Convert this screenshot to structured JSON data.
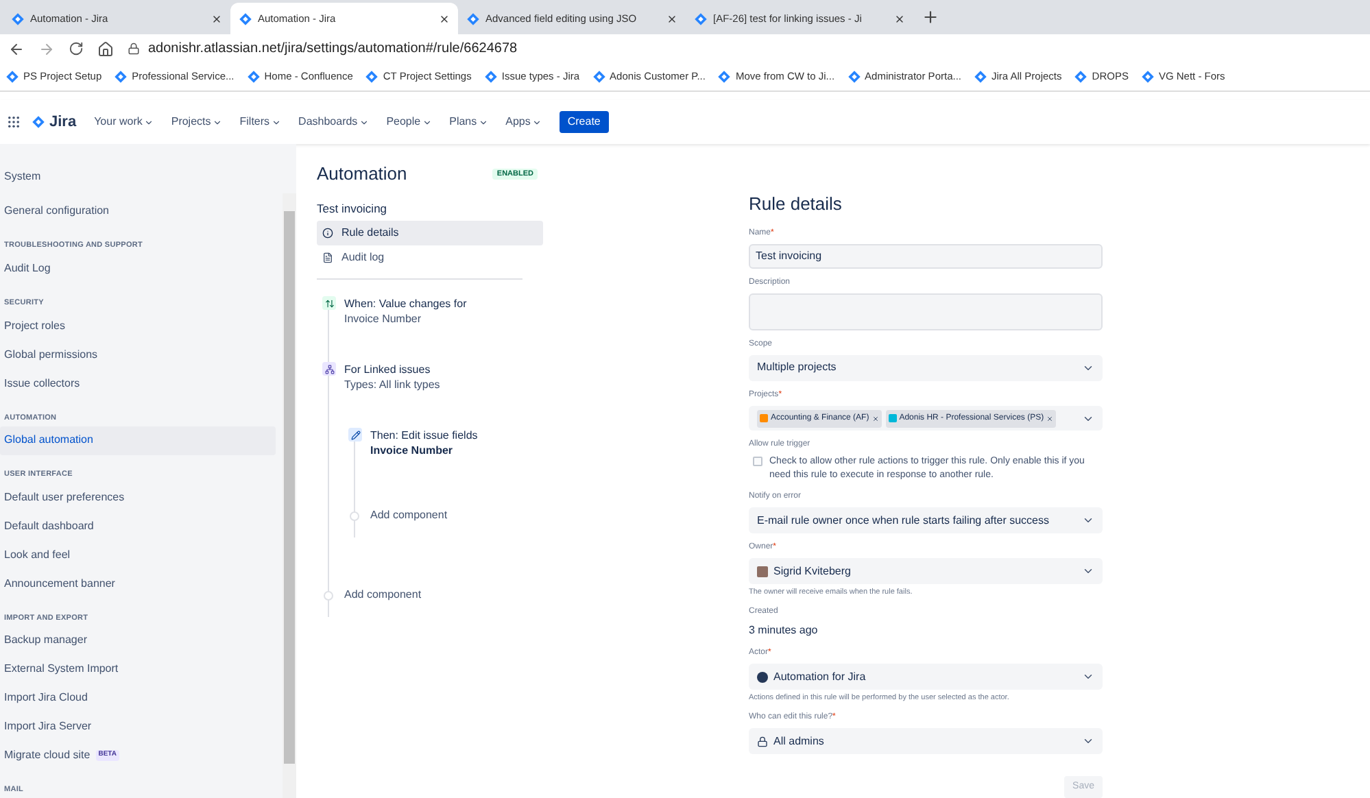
{
  "browser": {
    "tabs": [
      {
        "title": "Automation - Jira",
        "selected": false
      },
      {
        "title": "Automation - Jira",
        "selected": true
      },
      {
        "title": "Advanced field editing using JSO",
        "selected": false
      },
      {
        "title": "[AF-26] test for linking issues - Ji",
        "selected": false
      }
    ],
    "url": "adonishr.atlassian.net/jira/settings/automation#/rule/6624678",
    "bookmarks": [
      "PS Project Setup",
      "Professional Service...",
      "Home - Confluence",
      "CT Project Settings",
      "Issue types - Jira",
      "Adonis Customer P...",
      "Move from CW to Ji...",
      "Administrator Porta...",
      "Jira All Projects",
      "DROPS",
      "VG Nett - Fors"
    ]
  },
  "nav": {
    "product": "Jira",
    "items": [
      "Your work",
      "Projects",
      "Filters",
      "Dashboards",
      "People",
      "Plans",
      "Apps"
    ],
    "create": "Create"
  },
  "sidebar": {
    "items": [
      {
        "kind": "item",
        "label": "System",
        "selected": false
      },
      {
        "kind": "item",
        "label": "General configuration",
        "selected": false
      },
      {
        "kind": "heading",
        "label": "TROUBLESHOOTING AND SUPPORT"
      },
      {
        "kind": "item",
        "label": "Audit Log",
        "selected": false
      },
      {
        "kind": "heading",
        "label": "SECURITY"
      },
      {
        "kind": "item",
        "label": "Project roles",
        "selected": false
      },
      {
        "kind": "item",
        "label": "Global permissions",
        "selected": false
      },
      {
        "kind": "item",
        "label": "Issue collectors",
        "selected": false
      },
      {
        "kind": "heading",
        "label": "AUTOMATION"
      },
      {
        "kind": "item",
        "label": "Global automation",
        "selected": true
      },
      {
        "kind": "heading",
        "label": "USER INTERFACE"
      },
      {
        "kind": "item",
        "label": "Default user preferences",
        "selected": false
      },
      {
        "kind": "item",
        "label": "Default dashboard",
        "selected": false
      },
      {
        "kind": "item",
        "label": "Look and feel",
        "selected": false
      },
      {
        "kind": "item",
        "label": "Announcement banner",
        "selected": false
      },
      {
        "kind": "heading",
        "label": "IMPORT AND EXPORT"
      },
      {
        "kind": "item",
        "label": "Backup manager",
        "selected": false
      },
      {
        "kind": "item",
        "label": "External System Import",
        "selected": false
      },
      {
        "kind": "item",
        "label": "Import Jira Cloud",
        "selected": false
      },
      {
        "kind": "item",
        "label": "Import Jira Server",
        "selected": false
      },
      {
        "kind": "item",
        "label": "Migrate cloud site",
        "selected": false,
        "badge": "BETA"
      },
      {
        "kind": "heading",
        "label": "MAIL"
      }
    ]
  },
  "rule": {
    "title": "Automation",
    "status": "ENABLED",
    "name": "Test invoicing",
    "links": [
      {
        "label": "Rule details",
        "selected": true
      },
      {
        "label": "Audit log",
        "selected": false
      }
    ],
    "steps": [
      {
        "kind": "trigger",
        "title": "When: Value changes for",
        "detail": "Invoice Number"
      },
      {
        "kind": "branch",
        "title": "For Linked issues",
        "detail": "Types: All link types",
        "children": [
          {
            "kind": "action",
            "title": "Then: Edit issue fields",
            "detail": "Invoice Number"
          },
          {
            "kind": "add",
            "title": "Add component"
          }
        ]
      },
      {
        "kind": "add",
        "title": "Add component"
      }
    ]
  },
  "details": {
    "title": "Rule details",
    "fields": [
      {
        "kind": "text",
        "label": "Name",
        "mark": "*",
        "value": "Test invoicing"
      },
      {
        "kind": "textarea",
        "label": "Description"
      },
      {
        "kind": "select",
        "label": "Scope",
        "value": "Multiple projects"
      },
      {
        "kind": "tags",
        "label": "Projects",
        "mark": "*",
        "tags": [
          "Accounting & Finance (AF)",
          "Adonis HR - Professional Services (PS)"
        ]
      },
      {
        "kind": "checkbox",
        "label": "Allow rule trigger",
        "checked": false,
        "text": "Check to allow other rule actions to trigger this rule. Only enable this if you need this rule to execute in response to another rule."
      },
      {
        "kind": "select",
        "label": "Notify on error",
        "value": "E-mail rule owner once when rule starts failing after success"
      },
      {
        "kind": "owner",
        "label": "Owner",
        "mark": "*",
        "value": "Sigrid Kviteberg",
        "help": "The owner will receive emails when the rule fails."
      },
      {
        "kind": "static",
        "label": "Created",
        "value": "3 minutes ago"
      },
      {
        "kind": "actor",
        "label": "Actor",
        "mark": "*",
        "value": "Automation for Jira",
        "help": "Actions defined in this rule will be performed by the user selected as the actor."
      },
      {
        "kind": "access",
        "label": "Who can edit this rule?",
        "mark": "*",
        "value": "All admins"
      }
    ],
    "save": "Save"
  }
}
